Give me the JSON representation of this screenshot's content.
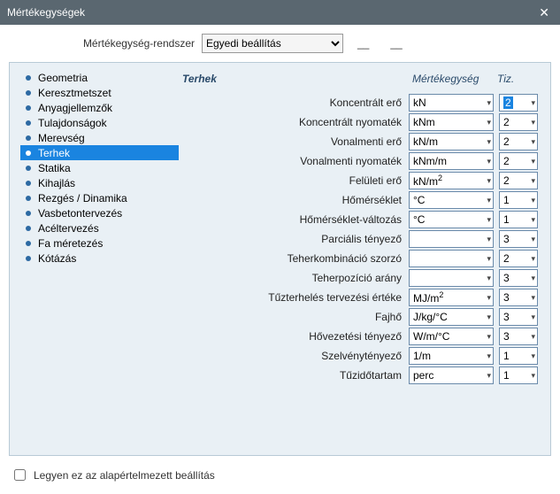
{
  "window": {
    "title": "Mértékegységek"
  },
  "system_row": {
    "label": "Mértékegység-rendszer",
    "value": "Egyedi beállítás"
  },
  "sidebar": {
    "items": [
      {
        "label": "Geometria"
      },
      {
        "label": "Keresztmetszet"
      },
      {
        "label": "Anyagjellemzők"
      },
      {
        "label": "Tulajdonságok"
      },
      {
        "label": "Merevség"
      },
      {
        "label": "Terhek"
      },
      {
        "label": "Statika"
      },
      {
        "label": "Kihajlás"
      },
      {
        "label": "Rezgés / Dinamika"
      },
      {
        "label": "Vasbetontervezés"
      },
      {
        "label": "Acéltervezés"
      },
      {
        "label": "Fa méretezés"
      },
      {
        "label": "Kótázás"
      }
    ],
    "selected_index": 5
  },
  "content": {
    "section_title": "Terhek",
    "col_unit": "Mértékegység",
    "col_dec": "Tiz.",
    "rows": [
      {
        "label": "Koncentrált erő",
        "unit": "kN",
        "dec": "2",
        "hl": true
      },
      {
        "label": "Koncentrált nyomaték",
        "unit": "kNm",
        "dec": "2"
      },
      {
        "label": "Vonalmenti erő",
        "unit": "kN/m",
        "dec": "2"
      },
      {
        "label": "Vonalmenti nyomaték",
        "unit": "kNm/m",
        "dec": "2"
      },
      {
        "label": "Felületi erő",
        "unit_html": "kN/m<sup>2</sup>",
        "dec": "2"
      },
      {
        "label": "Hőmérséklet",
        "unit": "°C",
        "dec": "1"
      },
      {
        "label": "Hőmérséklet-változás",
        "unit": "°C",
        "dec": "1"
      },
      {
        "label": "Parciális tényező",
        "unit": "",
        "dec": "3"
      },
      {
        "label": "Teherkombináció szorzó",
        "unit": "",
        "dec": "2"
      },
      {
        "label": "Teherpozíció arány",
        "unit": "",
        "dec": "3"
      },
      {
        "label": "Tűzterhelés tervezési értéke",
        "unit_html": "MJ/m<sup>2</sup>",
        "dec": "3"
      },
      {
        "label": "Fajhő",
        "unit": "J/kg/°C",
        "dec": "3"
      },
      {
        "label": "Hővezetési tényező",
        "unit": "W/m/°C",
        "dec": "3"
      },
      {
        "label": "Szelvénytényező",
        "unit": "1/m",
        "dec": "1"
      },
      {
        "label": "Tűzidőtartam",
        "unit": "perc",
        "dec": "1"
      }
    ]
  },
  "footer": {
    "checkbox_label": "Legyen ez az alapértelmezett beállítás"
  }
}
